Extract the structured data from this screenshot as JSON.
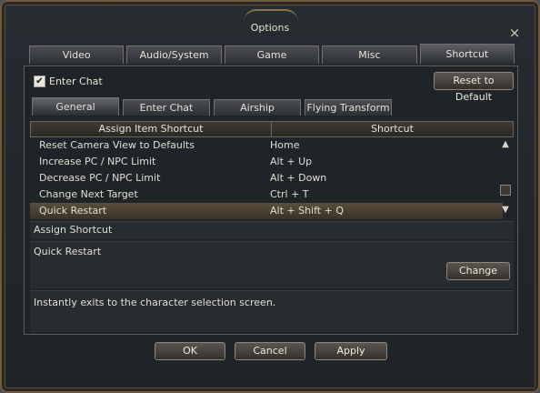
{
  "window": {
    "title": "Options",
    "close_icon": "×"
  },
  "top_tabs": [
    {
      "label": "Video"
    },
    {
      "label": "Audio/System"
    },
    {
      "label": "Game"
    },
    {
      "label": "Misc"
    },
    {
      "label": "Shortcut"
    }
  ],
  "enter_chat": {
    "label": "Enter Chat",
    "checked": true,
    "check_glyph": "✔"
  },
  "reset_button": "Reset to Default",
  "sub_tabs": [
    {
      "label": "General"
    },
    {
      "label": "Enter Chat"
    },
    {
      "label": "Airship"
    },
    {
      "label": "Flying Transform"
    }
  ],
  "table": {
    "headers": [
      "Assign Item Shortcut",
      "Shortcut"
    ],
    "rows": [
      {
        "action": "Reset Camera View to Defaults",
        "key": "Home"
      },
      {
        "action": "Increase PC / NPC Limit",
        "key": "Alt + Up"
      },
      {
        "action": "Decrease PC / NPC Limit",
        "key": "Alt + Down"
      },
      {
        "action": "Change Next Target",
        "key": "Ctrl + T"
      },
      {
        "action": "Quick Restart",
        "key": "Alt + Shift + Q"
      }
    ],
    "selected_index": 4
  },
  "assign": {
    "heading": "Assign Shortcut",
    "current": "Quick Restart",
    "change_button": "Change"
  },
  "description": "Instantly exits to the character selection screen.",
  "footer": {
    "ok": "OK",
    "cancel": "Cancel",
    "apply": "Apply"
  },
  "icons": {
    "scroll_up": "chevron-up-icon",
    "scroll_down": "chevron-down-icon"
  }
}
